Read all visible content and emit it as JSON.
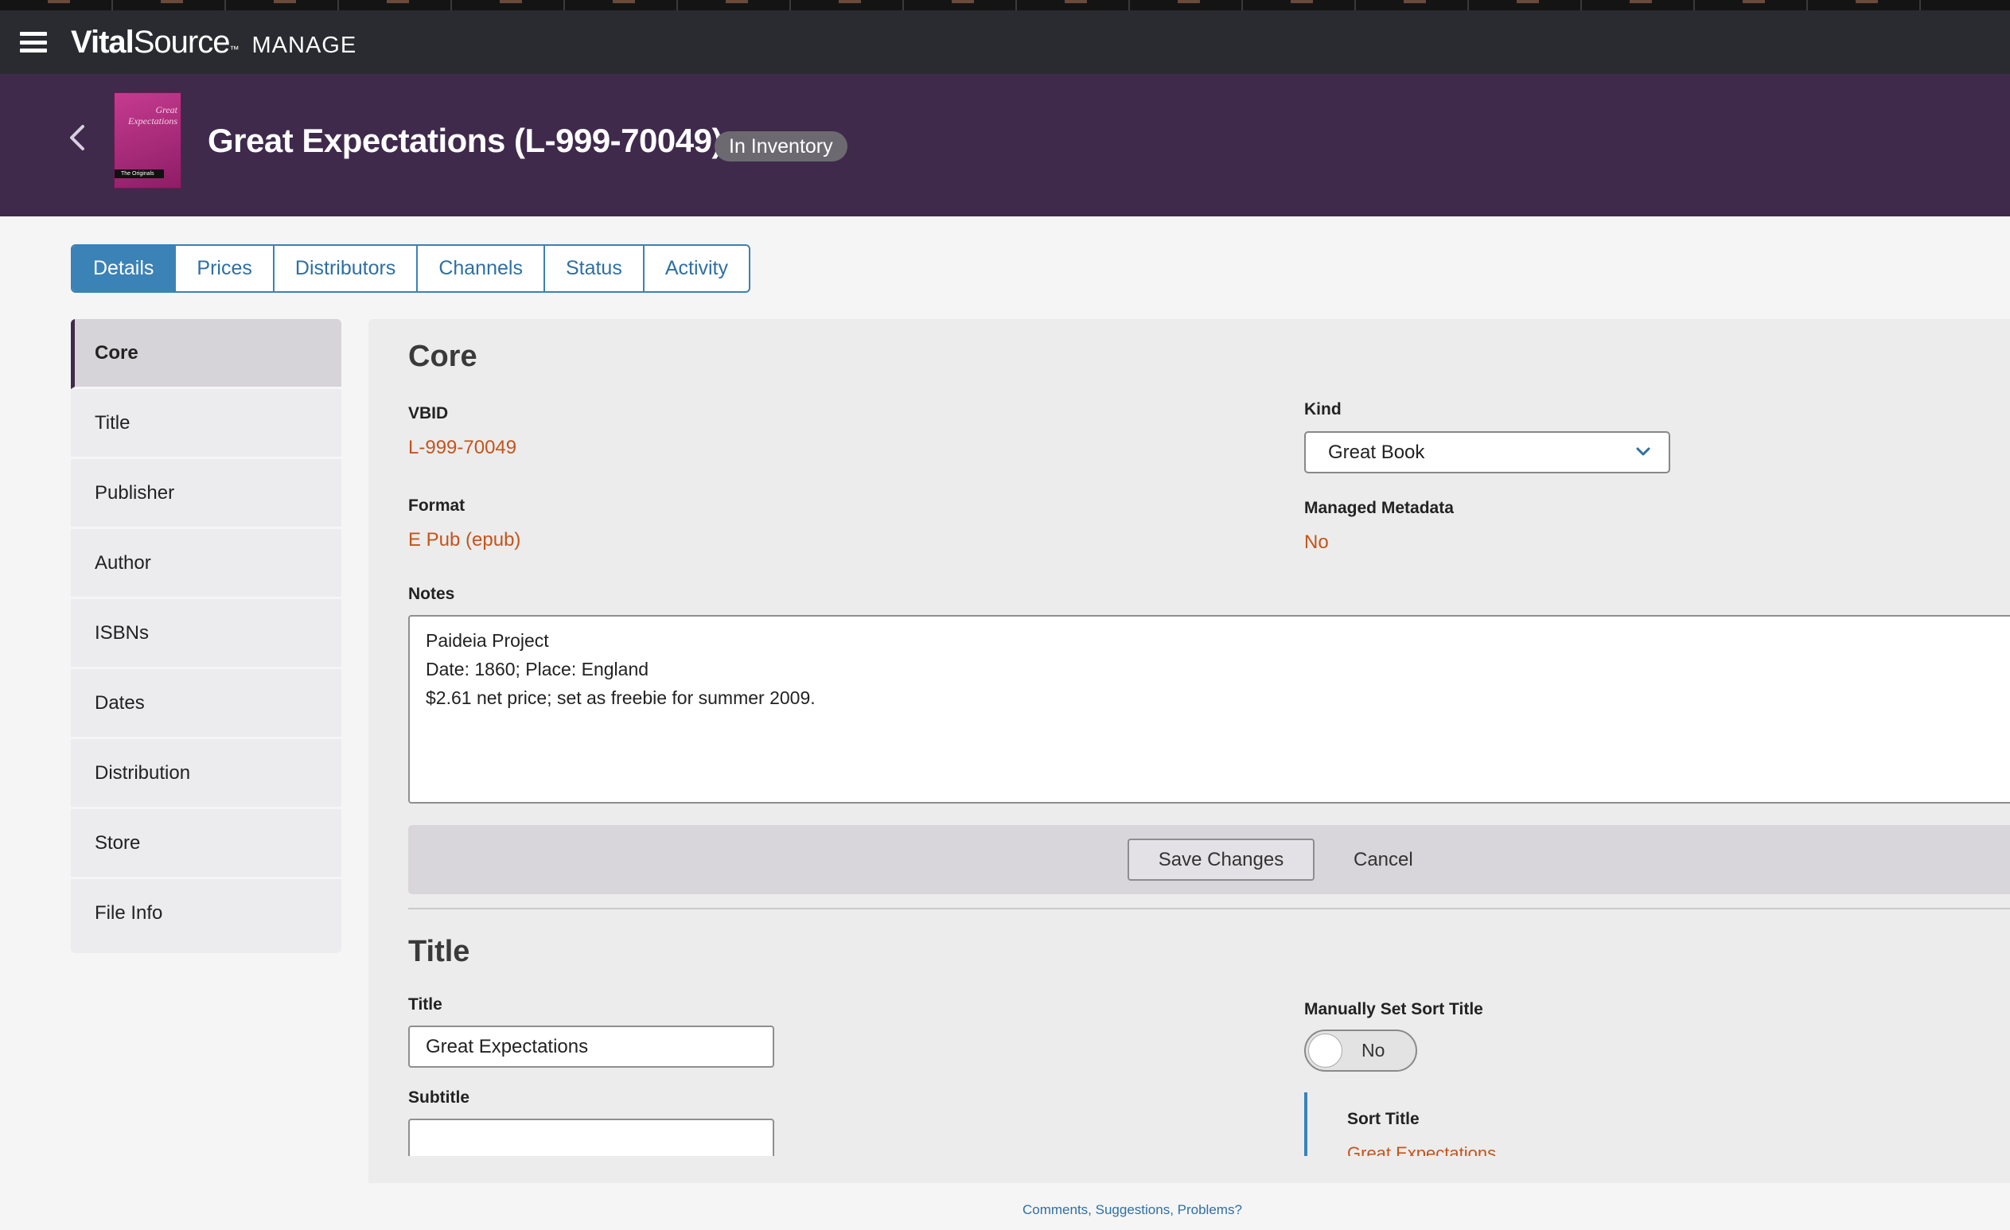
{
  "app": {
    "brand_bold": "Vital",
    "brand_light": "Source",
    "brand_tm": "™",
    "brand_suffix": "MANAGE"
  },
  "header": {
    "title": "Great Expectations (L-999-70049)",
    "badge": "In Inventory",
    "cover_title": "Great Expectations",
    "cover_band": "The Originals"
  },
  "tabs": [
    {
      "label": "Details",
      "active": true
    },
    {
      "label": "Prices"
    },
    {
      "label": "Distributors"
    },
    {
      "label": "Channels"
    },
    {
      "label": "Status"
    },
    {
      "label": "Activity"
    }
  ],
  "sidebar": {
    "items": [
      {
        "label": "Core",
        "active": true
      },
      {
        "label": "Title"
      },
      {
        "label": "Publisher"
      },
      {
        "label": "Author"
      },
      {
        "label": "ISBNs"
      },
      {
        "label": "Dates"
      },
      {
        "label": "Distribution"
      },
      {
        "label": "Store"
      },
      {
        "label": "File Info"
      }
    ]
  },
  "core": {
    "heading": "Core",
    "vbid_label": "VBID",
    "vbid_value": "L-999-70049",
    "format_label": "Format",
    "format_value": "E Pub (epub)",
    "kind_label": "Kind",
    "kind_value": "Great Book",
    "managed_label": "Managed Metadata",
    "managed_value": "No",
    "notes_label": "Notes",
    "notes_value": "Paideia Project\nDate: 1860; Place: England\n$2.61 net price; set as freebie for summer 2009."
  },
  "actions": {
    "save_label": "Save Changes",
    "cancel_label": "Cancel"
  },
  "title_section": {
    "heading": "Title",
    "title_label": "Title",
    "title_value": "Great Expectations",
    "subtitle_label": "Subtitle",
    "subtitle_value": "",
    "sort_manual_label": "Manually Set Sort Title",
    "sort_manual_value": "No",
    "sort_title_label": "Sort Title",
    "sort_title_value": "Great Expectations"
  },
  "footer": {
    "link": "Comments, Suggestions, Problems?"
  },
  "colors": {
    "topbar": "#2a2b30",
    "hero": "#3f2a4c",
    "accent": "#3b82b6",
    "value_text": "#c4541b"
  }
}
